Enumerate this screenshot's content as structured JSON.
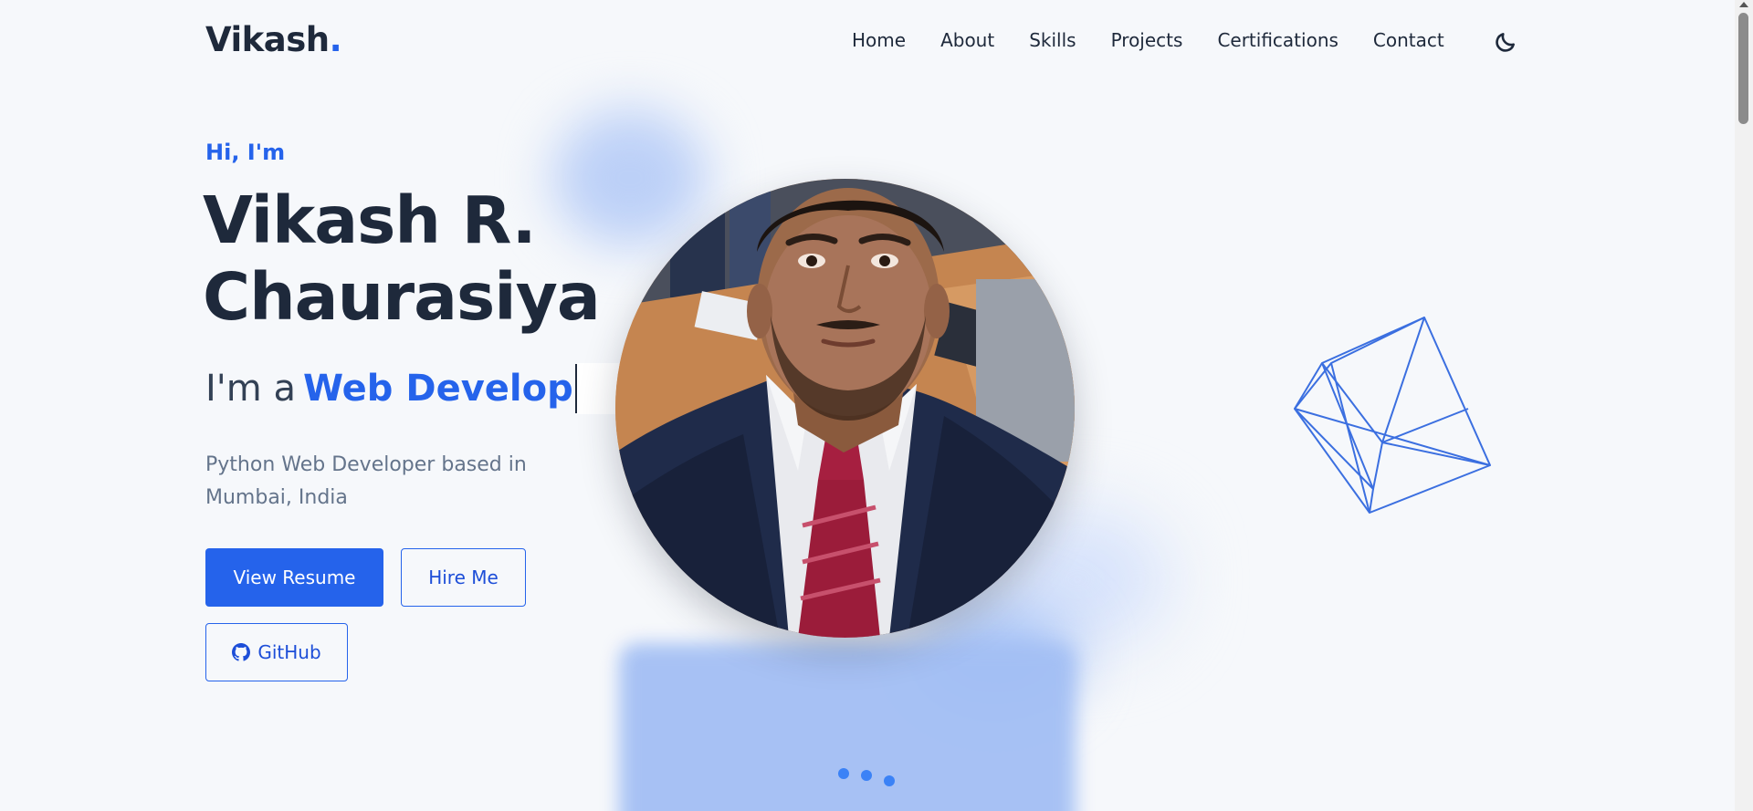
{
  "header": {
    "logo_text": "Vikash",
    "logo_dot": ".",
    "nav": [
      {
        "label": "Home"
      },
      {
        "label": "About"
      },
      {
        "label": "Skills"
      },
      {
        "label": "Projects"
      },
      {
        "label": "Certifications"
      },
      {
        "label": "Contact"
      }
    ],
    "theme_toggle_icon": "moon-icon"
  },
  "hero": {
    "greeting": "Hi, I'm",
    "name_line1": "Vikash R.",
    "name_line2": "Chaurasiya",
    "role_prefix": "I'm a",
    "role_typed": "Web Develop",
    "tagline": "Python Web Developer based in Mumbai, India",
    "buttons": {
      "resume": "View Resume",
      "hire": "Hire Me",
      "github": "GitHub"
    },
    "github_icon": "github-icon",
    "profile_image": "profile-photo",
    "decoration_icon": "wireframe-cube-icon",
    "loading_indicator": "loading-dots"
  },
  "colors": {
    "accent": "#2563eb",
    "text_dark": "#1e293b",
    "text_muted": "#64748b",
    "background": "#f6f8fb"
  }
}
